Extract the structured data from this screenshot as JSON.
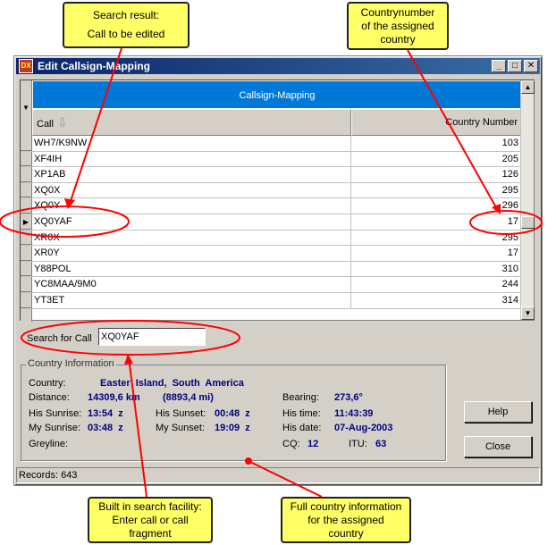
{
  "callouts": {
    "search_result": [
      "Search result:",
      "Call to be edited"
    ],
    "countrynumber": [
      "Countrynumber",
      "of the assigned",
      "country"
    ],
    "search_facility": [
      "Built in search facility:",
      "Enter call or call",
      "fragment"
    ],
    "country_info": [
      "Full country information",
      "for the assigned",
      "country"
    ]
  },
  "window": {
    "title": "Edit Callsign-Mapping",
    "app_icon_text": "DX",
    "controls": {
      "minimize": "_",
      "maximize": "□",
      "close": "✕"
    }
  },
  "grid": {
    "band_title": "Callsign-Mapping",
    "col_call": "Call",
    "col_country": "Country Number",
    "rows": [
      {
        "call": "WH7/K9NW",
        "country": "103"
      },
      {
        "call": "XF4IH",
        "country": "205"
      },
      {
        "call": "XP1AB",
        "country": "126"
      },
      {
        "call": "XQ0X",
        "country": "295"
      },
      {
        "call": "XQ0Y",
        "country": "296"
      },
      {
        "call": "XQ0YAF",
        "country": "17"
      },
      {
        "call": "XR0X",
        "country": "295"
      },
      {
        "call": "XR0Y",
        "country": "17"
      },
      {
        "call": "Y88POL",
        "country": "310"
      },
      {
        "call": "YC8MAA/9M0",
        "country": "244"
      },
      {
        "call": "YT3ET",
        "country": "314"
      }
    ],
    "selected_index": 5
  },
  "search": {
    "label": "Search for Call",
    "value": "XQ0YAF"
  },
  "country_info": {
    "legend": "Country Information",
    "country_label": "Country:",
    "country_value": "Easter Island, South America",
    "distance_label": "Distance:",
    "distance_km": "14309,6 km",
    "distance_mi": "(8893,4 mi)",
    "bearing_label": "Bearing:",
    "bearing_value": "273,6°",
    "his_sunrise_label": "His Sunrise:",
    "his_sunrise_value": "13:54  z",
    "his_sunset_label": "His Sunset:",
    "his_sunset_value": "00:48  z",
    "his_time_label": "His time:",
    "his_time_value": "11:43:39",
    "my_sunrise_label": "My Sunrise:",
    "my_sunrise_value": "03:48  z",
    "my_sunset_label": "My Sunset:",
    "my_sunset_value": "19:09  z",
    "his_date_label": "His date:",
    "his_date_value": "07-Aug-2003",
    "greyline_label": "Greyline:",
    "cq_label": "CQ:",
    "cq_value": "12",
    "itu_label": "ITU:",
    "itu_value": "63"
  },
  "buttons": {
    "help": "Help",
    "close": "Close"
  },
  "status": {
    "records": "Records: 643"
  },
  "colors": {
    "callout": "#ffff66",
    "annotation": "#ff0000",
    "band": "#0078d7",
    "title": "#0a246a",
    "value": "#000080"
  }
}
